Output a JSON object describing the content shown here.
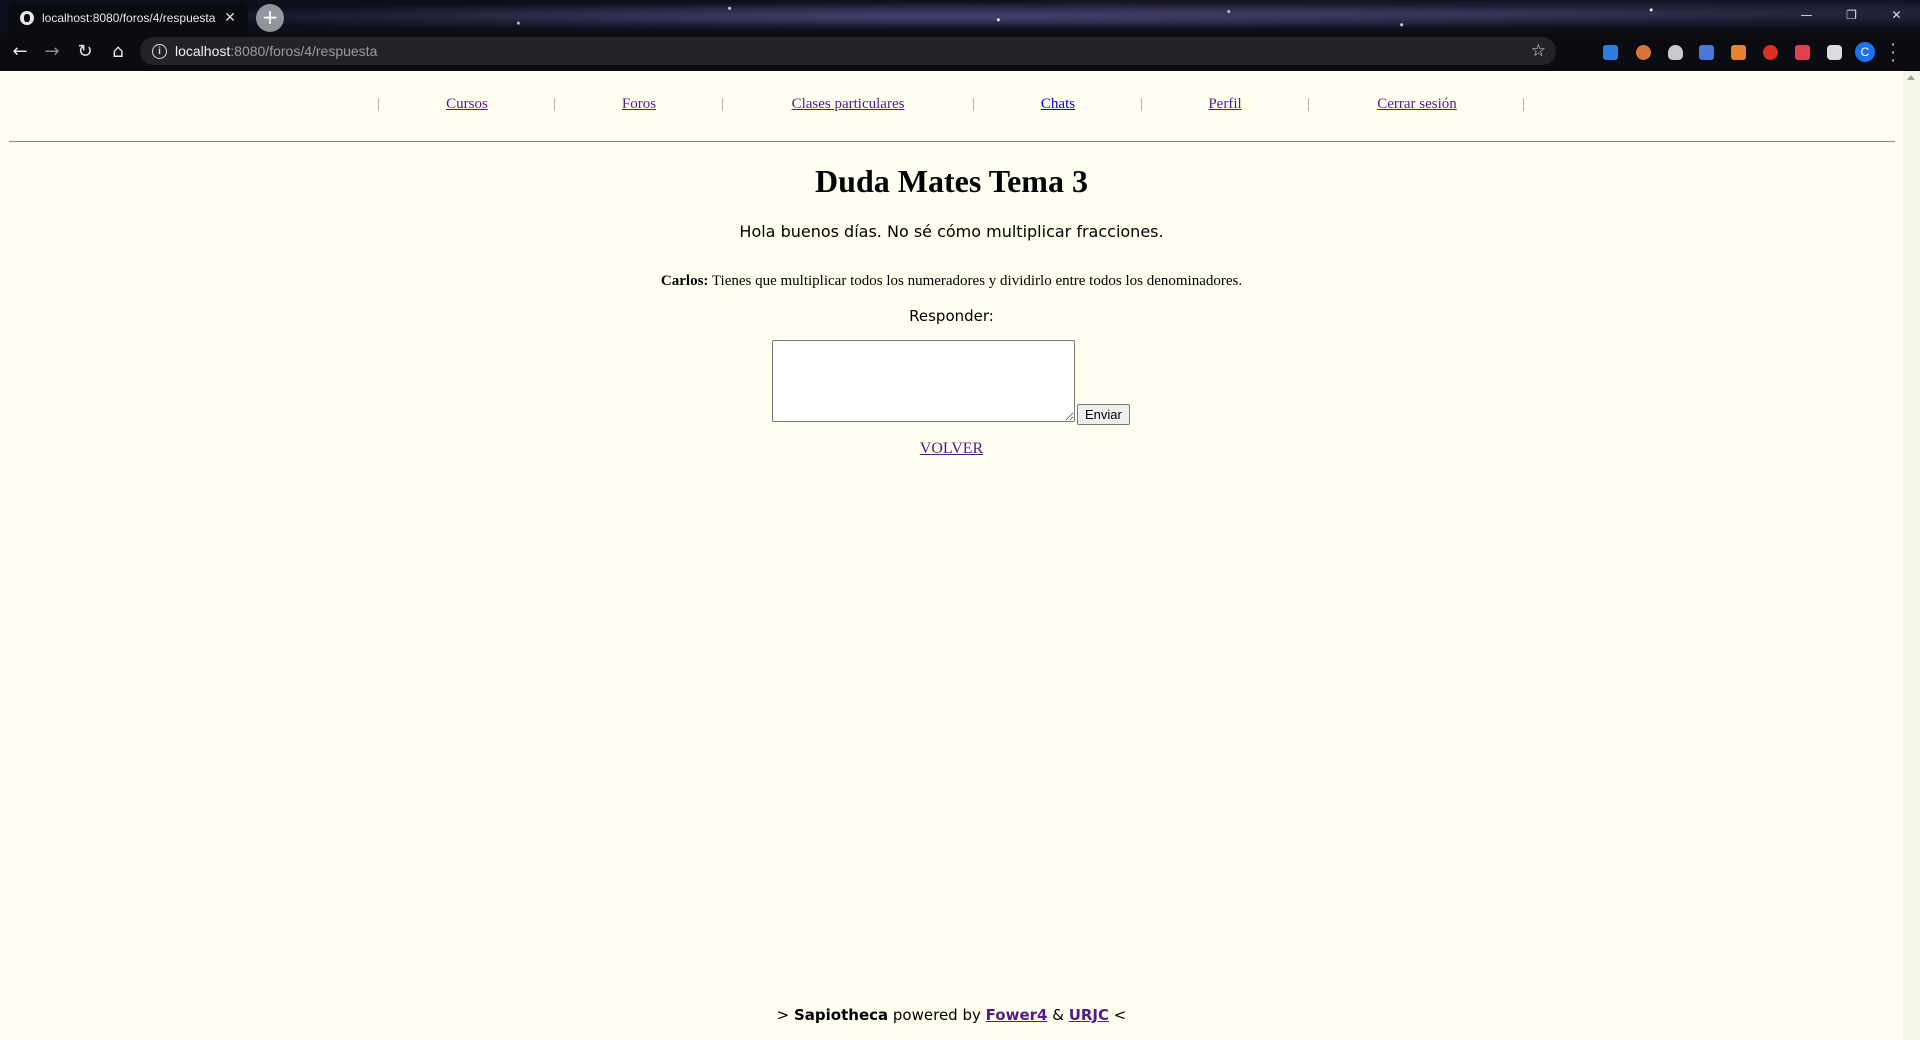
{
  "browser": {
    "tab_title": "localhost:8080/foros/4/respuesta",
    "tab_close": "✕",
    "new_tab": "+",
    "url_host": "localhost",
    "url_path": ":8080/foros/4/respuesta",
    "window_controls": {
      "minimize": "—",
      "restore": "❐",
      "close": "✕"
    },
    "nav_glyphs": {
      "back": "←",
      "forward": "→",
      "reload": "↻",
      "home": "⌂"
    },
    "profile_initial": "C",
    "extension_colors": [
      "#2f7de1",
      "#d9743b",
      "#c9c9c9",
      "#4a78d8",
      "#e8832b",
      "#d93025",
      "#e04050",
      "#dddddd"
    ]
  },
  "nav": {
    "separator": "|",
    "items": [
      {
        "label": "Cursos"
      },
      {
        "label": "Foros"
      },
      {
        "label": "Clases particulares"
      },
      {
        "label": "Chats"
      },
      {
        "label": "Perfil"
      },
      {
        "label": "Cerrar sesión"
      }
    ]
  },
  "thread": {
    "title": "Duda Mates Tema 3",
    "question": "Hola buenos días. No sé cómo multiplicar fracciones.",
    "answers": [
      {
        "author": "Carlos:",
        "text": " Tienes que multiplicar todos los numeradores y dividirlo entre todos los denominadores."
      }
    ]
  },
  "reply": {
    "label": "Responder:",
    "value": "",
    "send_label": "Enviar"
  },
  "back_label": "VOLVER",
  "footer": {
    "prefix": "> ",
    "brand": "Sapiotheca",
    "middle": " powered by ",
    "link1": "Fower4",
    "amp": " & ",
    "link2": "URJC",
    "suffix": " <"
  }
}
